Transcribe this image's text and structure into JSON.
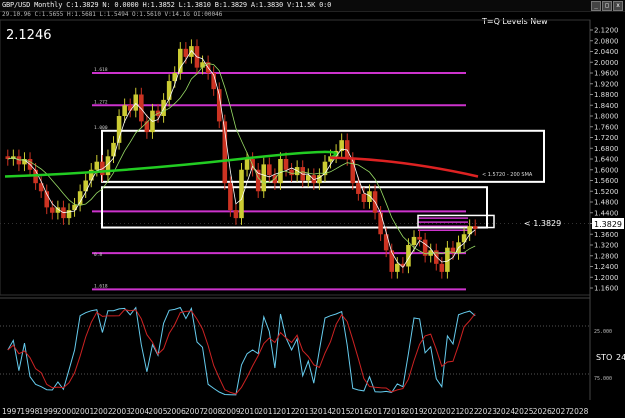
{
  "window": {
    "title_line": "GBP/USD Monthly  C:1.3829  N: 0.0000 H:1.3852 L:1.3810 B:1.3829 A:1.3830 V:11.5K 0:0",
    "info_line": "29.10.96  C:1.5655 H:1.5681 L:1.5494 O:1.5610 V:14.1G OI:00046",
    "controls": [
      "_",
      "□",
      "x"
    ]
  },
  "overlay": {
    "big_price": "2.1246",
    "study_label": "T=Q Levels New",
    "sma_label": "<  1.5720 - 200 SMA",
    "last_price_tag": "<  1.3829",
    "last_price_box": "1.3829"
  },
  "oscillator": {
    "label": "STO",
    "level_label": "24",
    "upper_level": "25.000",
    "lower_level": "75.000"
  },
  "fib_labels": [
    {
      "text": "1.618",
      "price": 1.96
    },
    {
      "text": "1.272",
      "price": 1.84
    },
    {
      "text": "1.000",
      "price": 1.745
    },
    {
      "text": "0.8",
      "price": 1.272
    },
    {
      "text": "1.618",
      "price": 1.155
    }
  ],
  "chart_data": {
    "type": "candlestick",
    "symbol": "GBP/USD",
    "timeframe": "Monthly",
    "ylim": [
      1.1,
      2.13
    ],
    "price_ticks": [
      "2.1200",
      "2.0800",
      "2.0400",
      "2.0000",
      "1.9600",
      "1.9200",
      "1.8800",
      "1.8400",
      "1.8000",
      "1.7600",
      "1.7200",
      "1.6800",
      "1.6400",
      "1.6000",
      "1.5600",
      "1.5200",
      "1.4800",
      "1.4400",
      "1.4000",
      "1.3600",
      "1.3200",
      "1.2800",
      "1.2400",
      "1.2000",
      "1.1600"
    ],
    "years": [
      "1997",
      "1998",
      "1999",
      "2000",
      "2001",
      "2002",
      "2003",
      "2004",
      "2005",
      "2006",
      "2007",
      "2008",
      "2009",
      "2010",
      "2011",
      "2012",
      "2013",
      "2014",
      "2015",
      "2016",
      "2017",
      "2018",
      "2019",
      "2020",
      "2021",
      "2022",
      "2023",
      "2024",
      "2025",
      "2026",
      "2027",
      "2028"
    ],
    "closes": [
      1.64,
      1.65,
      1.62,
      1.64,
      1.6,
      1.55,
      1.52,
      1.46,
      1.44,
      1.46,
      1.42,
      1.45,
      1.47,
      1.52,
      1.56,
      1.6,
      1.63,
      1.58,
      1.65,
      1.7,
      1.8,
      1.84,
      1.82,
      1.88,
      1.78,
      1.74,
      1.82,
      1.8,
      1.86,
      1.93,
      1.96,
      2.05,
      2.02,
      2.06,
      1.98,
      2.0,
      1.96,
      1.9,
      1.78,
      1.55,
      1.45,
      1.42,
      1.6,
      1.64,
      1.6,
      1.52,
      1.62,
      1.58,
      1.55,
      1.64,
      1.6,
      1.58,
      1.61,
      1.56,
      1.58,
      1.55,
      1.58,
      1.63,
      1.65,
      1.67,
      1.71,
      1.64,
      1.55,
      1.51,
      1.48,
      1.52,
      1.44,
      1.36,
      1.3,
      1.22,
      1.25,
      1.24,
      1.32,
      1.35,
      1.34,
      1.28,
      1.3,
      1.25,
      1.22,
      1.31,
      1.29,
      1.33,
      1.36,
      1.39,
      1.38
    ],
    "horizontal_levels": [
      1.96,
      1.84,
      1.445,
      1.29,
      1.155
    ],
    "level_boxes": [
      [
        1.745,
        1.555
      ],
      [
        1.535,
        1.385
      ],
      [
        1.423,
        1.385
      ]
    ],
    "sma_200_label_value": 1.572,
    "last_price": 1.3829,
    "series": [
      {
        "name": "200 SMA",
        "color": "#d42020"
      },
      {
        "name": "MA",
        "color": "#33dd33"
      }
    ]
  },
  "colors": {
    "level_line": "#cc33cc",
    "box": "#ffffff",
    "sma_red": "#dd2222",
    "sma_green": "#22cc22",
    "stoch_k": "#66ccee",
    "stoch_d": "#cc2222",
    "candle_up": "#cccc33",
    "candle_down": "#cc3322"
  }
}
